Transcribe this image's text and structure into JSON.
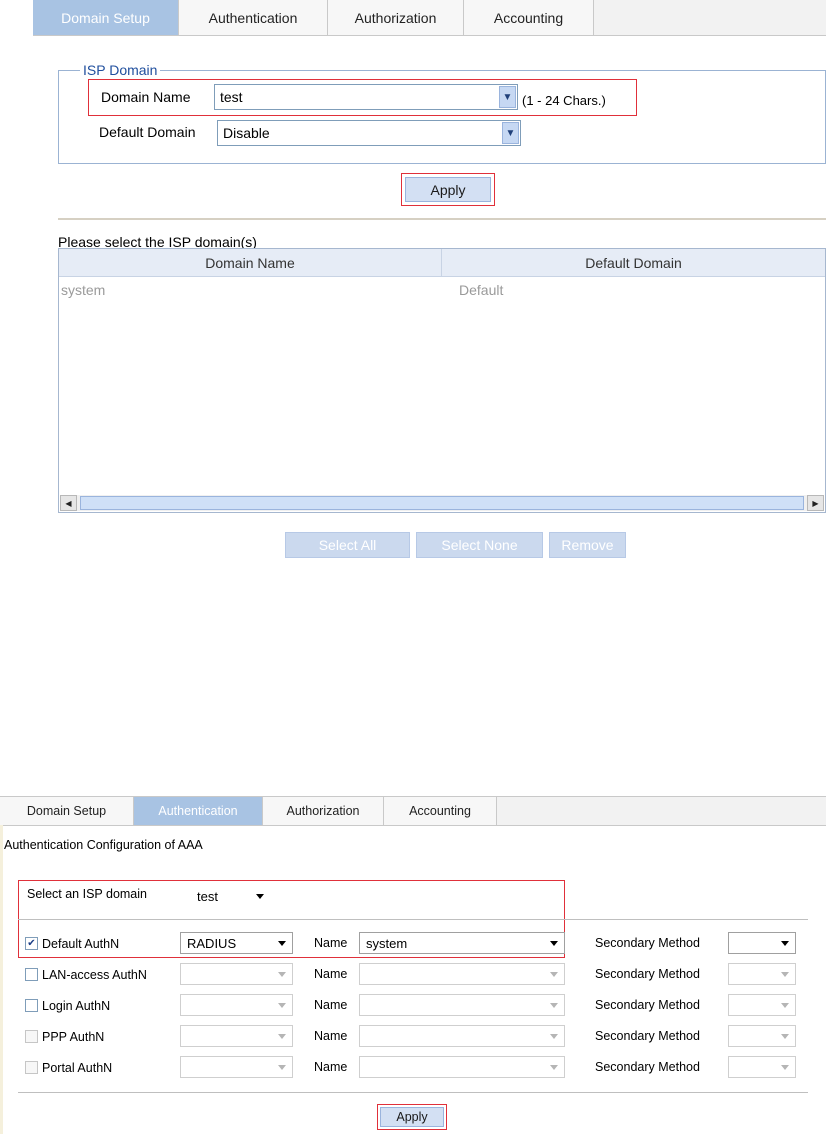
{
  "panel1": {
    "tabs": [
      "Domain Setup",
      "Authentication",
      "Authorization",
      "Accounting"
    ],
    "legend": "ISP Domain",
    "domain_name_label": "Domain Name",
    "domain_name_value": "test",
    "domain_name_hint": "(1 - 24 Chars.)",
    "default_domain_label": "Default Domain",
    "default_domain_value": "Disable",
    "apply": "Apply",
    "list_caption": "Please select the ISP domain(s)",
    "columns": [
      "Domain Name",
      "Default Domain"
    ],
    "rows": [
      [
        "system",
        "Default"
      ]
    ],
    "buttons": [
      "Select All",
      "Select None",
      "Remove"
    ]
  },
  "panel2": {
    "tabs": [
      "Domain Setup",
      "Authentication",
      "Authorization",
      "Accounting"
    ],
    "heading": "Authentication Configuration of AAA",
    "select_domain_label": "Select an ISP domain",
    "select_domain_value": "test",
    "name_label": "Name",
    "secondary_label": "Secondary Method",
    "rows": [
      {
        "label": "Default AuthN",
        "checked": true,
        "method": "RADIUS",
        "name": "system"
      },
      {
        "label": "LAN-access AuthN",
        "checked": false,
        "method": "",
        "name": ""
      },
      {
        "label": "Login AuthN",
        "checked": false,
        "method": "",
        "name": ""
      },
      {
        "label": "PPP AuthN",
        "checked": false,
        "method": "",
        "name": ""
      },
      {
        "label": "Portal AuthN",
        "checked": false,
        "method": "",
        "name": ""
      }
    ],
    "apply": "Apply"
  },
  "colors": {
    "active_tab": "#a8c3e3",
    "highlight": "#e0303a",
    "button": "#d3e0f3"
  }
}
